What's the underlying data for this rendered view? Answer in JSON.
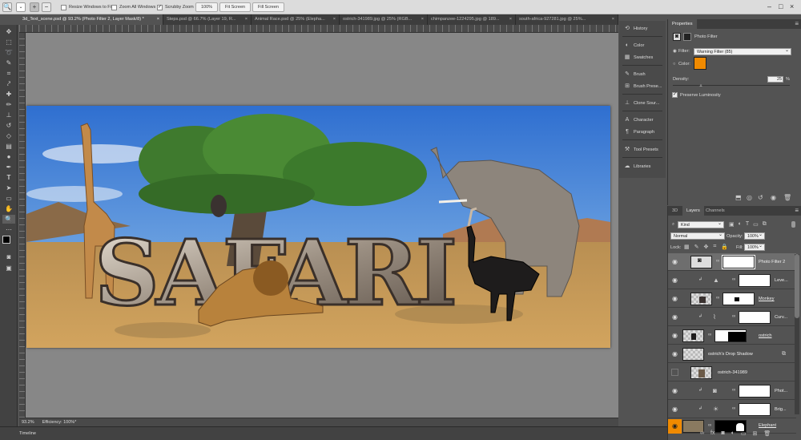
{
  "options_bar": {
    "resize_windows_label": "Resize Windows to Fit",
    "zoom_all_label": "Zoom All Windows",
    "scrubby_zoom_label": "Scrubby Zoom",
    "zoom_100_label": "100%",
    "fit_screen_label": "Fit Screen",
    "fill_screen_label": "Fill Screen"
  },
  "doc_tabs": [
    {
      "label": "3d_Text_scene.psd @ 93.2% (Photo Filter 2, Layer Mask/8) *",
      "close": "×"
    },
    {
      "label": "Steps.psd @ 66.7% (Layer 19, R...",
      "close": "×"
    },
    {
      "label": "Animal Race.psd @ 25% (Elepha...",
      "close": "×"
    },
    {
      "label": "ostrich-341989.jpg @ 25% (RGB...",
      "close": "×"
    },
    {
      "label": "chimpanzee-1224295.jpg @ 189...",
      "close": "×"
    },
    {
      "label": "south-africa-927281.jpg @ 25%...",
      "close": "×"
    }
  ],
  "canvas_text": "SAFARI",
  "status": {
    "zoom": "93.2%",
    "efficiency": "Efficiency: 100%*"
  },
  "timeline_label": "Timeline",
  "dock": {
    "history": "History",
    "color": "Color",
    "swatches": "Swatches",
    "brush": "Brush",
    "brush_presets": "Brush Prese...",
    "clone_source": "Clone Sour...",
    "character": "Character",
    "paragraph": "Paragraph",
    "tool_presets": "Tool Presets",
    "libraries": "Libraries"
  },
  "properties": {
    "tab": "Properties",
    "title": "Photo Filter",
    "filter_label": "Filter:",
    "filter_value": "Warning Filter (85)",
    "color_label": "Color:",
    "color_swatch": "#f08a00",
    "density_label": "Density:",
    "density_value": "25",
    "density_unit": "%",
    "density": 0.25,
    "preserve_label": "Preserve Luminosity"
  },
  "layers_panel": {
    "tabs": [
      "3D",
      "Layers",
      "Channels"
    ],
    "kind_label": "Kind",
    "blend_mode": "Normal",
    "opacity_label": "Opacity:",
    "opacity_value": "100%",
    "lock_label": "Lock:",
    "fill_label": "Fill:",
    "fill_value": "100%",
    "rows": [
      {
        "name": "Photo Filter 2"
      },
      {
        "name": "Leve..."
      },
      {
        "name": "Monkey"
      },
      {
        "name": "Curv..."
      },
      {
        "name": "ostrich"
      },
      {
        "name": "ostrich's Drop Shadow"
      },
      {
        "name": "ostrich-341989"
      },
      {
        "name": "Phot..."
      },
      {
        "name": "Brig..."
      },
      {
        "name": "Elephant"
      }
    ]
  },
  "colors": {
    "accent_orange": "#f08a00",
    "panel_bg": "#535353",
    "sky": "#3b79d6",
    "ground": "#c49a55"
  }
}
